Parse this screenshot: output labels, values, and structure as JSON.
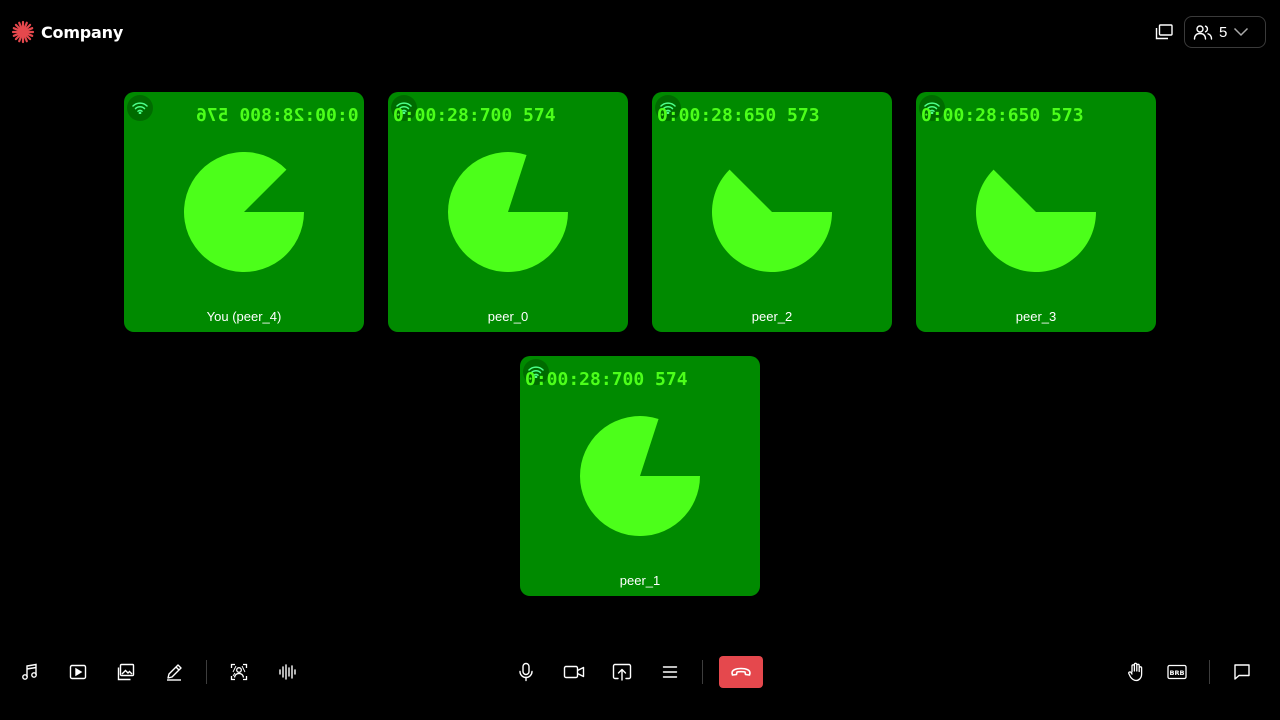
{
  "header": {
    "brand_name": "Company",
    "brand_icon": "sunburst-logo-icon",
    "brand_color": "#e5484d",
    "layout_icon": "layout-toggle-icon",
    "participants": {
      "icon": "users-icon",
      "count": "5",
      "chevron_icon": "chevron-down-icon"
    }
  },
  "tiles": [
    {
      "name": "You (peer_4)",
      "timestamp": "0:00:28:800 576",
      "mirrored": true,
      "pie_fraction": 0.875
    },
    {
      "name": "peer_0",
      "timestamp": "0:00:28:700 574",
      "mirrored": false,
      "pie_fraction": 0.8
    },
    {
      "name": "peer_2",
      "timestamp": "0:00:28:650 573",
      "mirrored": false,
      "pie_fraction": 0.625
    },
    {
      "name": "peer_3",
      "timestamp": "0:00:28:650 573",
      "mirrored": false,
      "pie_fraction": 0.625
    },
    {
      "name": "peer_1",
      "timestamp": "0:00:28:700 574",
      "mirrored": false,
      "pie_fraction": 0.8
    }
  ],
  "colors": {
    "tile_bg": "#008a00",
    "pie": "#4cff1a",
    "timestamp": "#4cff1a",
    "leave": "#e5484d"
  },
  "toolbar": {
    "left": [
      "music-note-icon",
      "play-video-icon",
      "image-gallery-icon",
      "pencil-icon",
      "virtual-background-icon",
      "audio-waveform-icon"
    ],
    "center": [
      "microphone-icon",
      "camera-icon",
      "screen-share-icon",
      "menu-icon",
      "leave-call-icon"
    ],
    "right": [
      "raise-hand-icon",
      "brb-icon",
      "chat-icon"
    ],
    "brb_label": "BRB"
  }
}
